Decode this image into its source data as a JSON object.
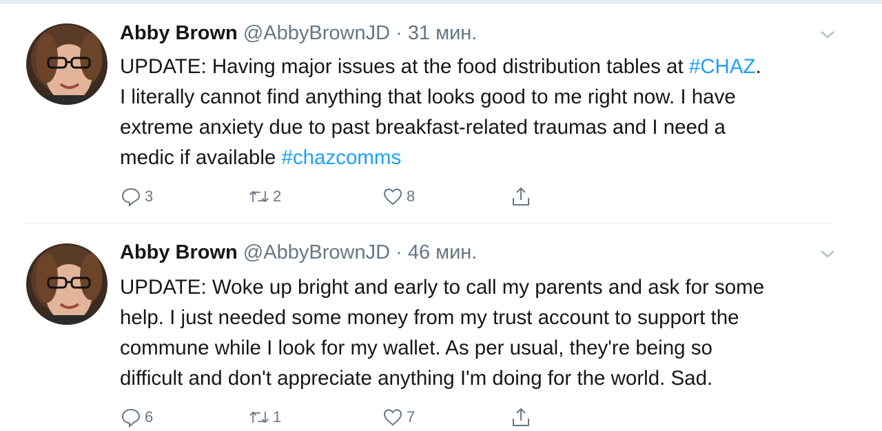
{
  "tweets": [
    {
      "name": "Abby Brown",
      "handle": "@AbbyBrownJD",
      "separator": "·",
      "time": "31 мин.",
      "text_parts": [
        "UPDATE: Having major issues at the food distribution tables at ",
        "#CHAZ",
        ".",
        "I literally cannot find anything that looks good to me right now. I have",
        "extreme anxiety due to past breakfast-related traumas and I need a",
        "medic if available ",
        "#chazcomms"
      ],
      "replies": "3",
      "retweets": "2",
      "likes": "8"
    },
    {
      "name": "Abby Brown",
      "handle": "@AbbyBrownJD",
      "separator": "·",
      "time": "46 мин.",
      "lines": [
        "UPDATE: Woke up bright and early to call my parents and ask for some",
        "help. I just needed some money from my trust account to support the",
        "commune while I look for my wallet. As per usual, they're being so",
        "difficult and don't appreciate anything I'm doing for the world. Sad."
      ],
      "replies": "6",
      "retweets": "1",
      "likes": "7"
    }
  ],
  "icons": {
    "reply": "reply-icon",
    "retweet": "retweet-icon",
    "like": "heart-icon",
    "share": "share-icon",
    "menu": "chevron-down-icon"
  },
  "colors": {
    "text": "#14171a",
    "secondary": "#657786",
    "link": "#1da1f2",
    "divider": "#e6ecf0"
  }
}
